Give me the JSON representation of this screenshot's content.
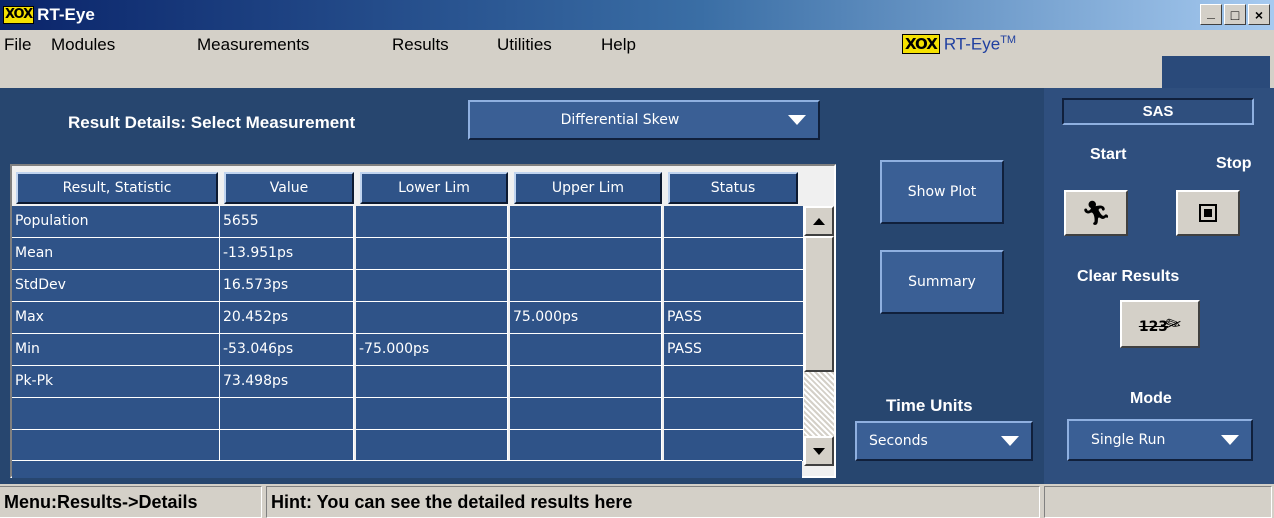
{
  "window": {
    "logo_text": "XOX",
    "title": "RT-Eye",
    "minimize": "_",
    "maximize": "□",
    "close": "×"
  },
  "menu": {
    "items": [
      "File",
      "Modules",
      "Measurements",
      "Results",
      "Utilities",
      "Help"
    ],
    "brand_logo": "XOX",
    "brand_name": "RT-Eye",
    "brand_tm": "TM"
  },
  "result_details": {
    "label": "Result Details: Select Measurement",
    "measurement": "Differential Skew"
  },
  "table": {
    "columns": [
      "Result, Statistic",
      "Value",
      "Lower Lim",
      "Upper Lim",
      "Status"
    ],
    "rows": [
      [
        "Population",
        "5655",
        "",
        "",
        ""
      ],
      [
        "Mean",
        "-13.951ps",
        "",
        "",
        ""
      ],
      [
        "StdDev",
        "16.573ps",
        "",
        "",
        ""
      ],
      [
        "Max",
        "20.452ps",
        "",
        "75.000ps",
        "PASS"
      ],
      [
        "Min",
        "-53.046ps",
        "-75.000ps",
        "",
        "PASS"
      ],
      [
        "Pk-Pk",
        "73.498ps",
        "",
        "",
        ""
      ],
      [
        "",
        "",
        "",
        "",
        ""
      ],
      [
        "",
        "",
        "",
        "",
        ""
      ]
    ]
  },
  "buttons": {
    "show_plot": "Show Plot",
    "summary": "Summary"
  },
  "time_units": {
    "label": "Time Units",
    "value": "Seconds"
  },
  "side": {
    "standard": "SAS",
    "start": "Start",
    "stop": "Stop",
    "clear_results": "Clear Results",
    "clear_icon_text": "123",
    "mode_label": "Mode",
    "mode_value": "Single Run"
  },
  "status": {
    "location": "Menu:Results->Details",
    "hint": "Hint: You can see the detailed results here"
  },
  "colors": {
    "panel": "#27466f",
    "cell": "#2f5388",
    "title_start": "#0a246a",
    "logo": "#f5e100"
  }
}
